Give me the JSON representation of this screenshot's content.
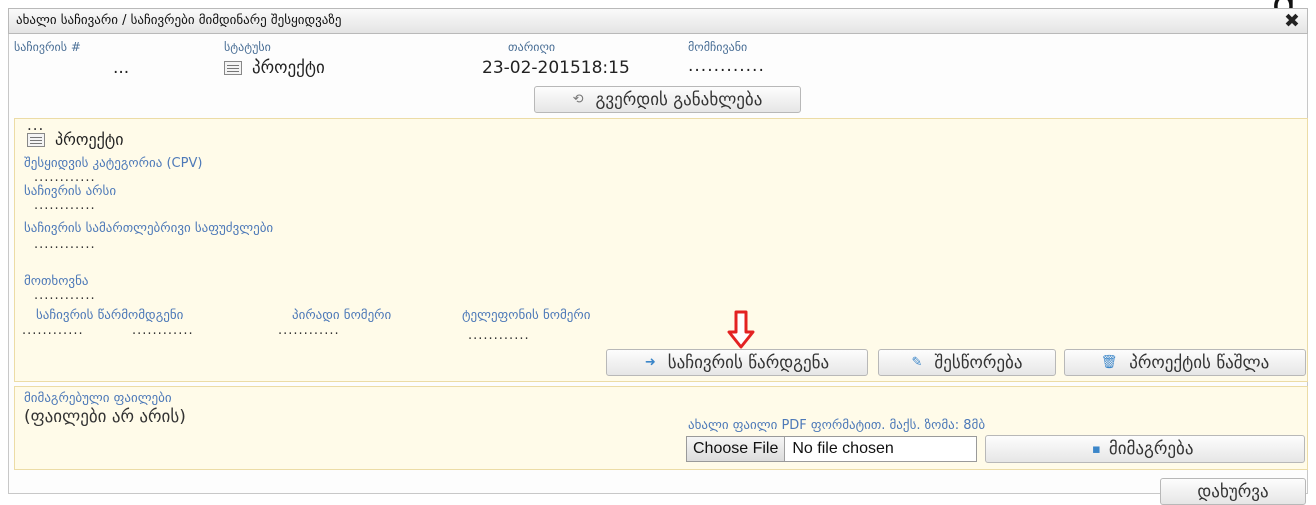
{
  "corner_glyph": "g",
  "dialog": {
    "title": "ახალი საჩივარი / საჩივრები მიმდინარე შესყიდვაზე",
    "close_glyph": "✖"
  },
  "header": {
    "complaint_no_label": "საჩივრის #",
    "complaint_no_value": "...",
    "status_label": "სტატუსი",
    "status_value": "პროექტი",
    "date_label": "თარიღი",
    "date_value": "23-02-201518:15",
    "complainant_label": "მომჩივანი",
    "complainant_value": "............"
  },
  "refresh_button": {
    "label": "გვერდის განახლება",
    "icon": "refresh-icon"
  },
  "project_panel": {
    "top_dots": "...",
    "status_value": "პროექტი",
    "cpv_label": "შესყიდვის კატეგორია (CPV)",
    "cpv_value": "............",
    "essence_label": "საჩივრის არსი",
    "essence_value": "............",
    "legal_label": "საჩივრის სამართლებრივი საფუძვლები",
    "legal_value": "............",
    "demand_label": "მოთხოვნა",
    "demand_value": "............",
    "rep_label": "საჩივრის წარმომდგენი",
    "rep_value_1": "............",
    "rep_value_2": "............",
    "id_label": "პირადი ნომერი",
    "id_value": "............",
    "phone_label": "ტელეფონის ნომერი",
    "phone_value": "............"
  },
  "actions": {
    "submit_label": "საჩივრის წარდგენა",
    "edit_label": "შესწორება",
    "delete_label": "პროექტის წაშლა"
  },
  "attachments": {
    "label": "მიმაგრებული ფაილები",
    "empty_text": "(ფაილები არ არის)",
    "new_file_hint": "ახალი ფაილი PDF ფორმატით. მაქს. ზომა: 8მბ",
    "choose_file_label": "Choose File",
    "no_file_text": "No file chosen",
    "attach_label": "მიმაგრება"
  },
  "footer": {
    "close_label": "დახურვა"
  },
  "colors": {
    "accent_red": "#e32222",
    "label_blue": "#4d79b8",
    "panel_bg": "#fffbe9"
  }
}
